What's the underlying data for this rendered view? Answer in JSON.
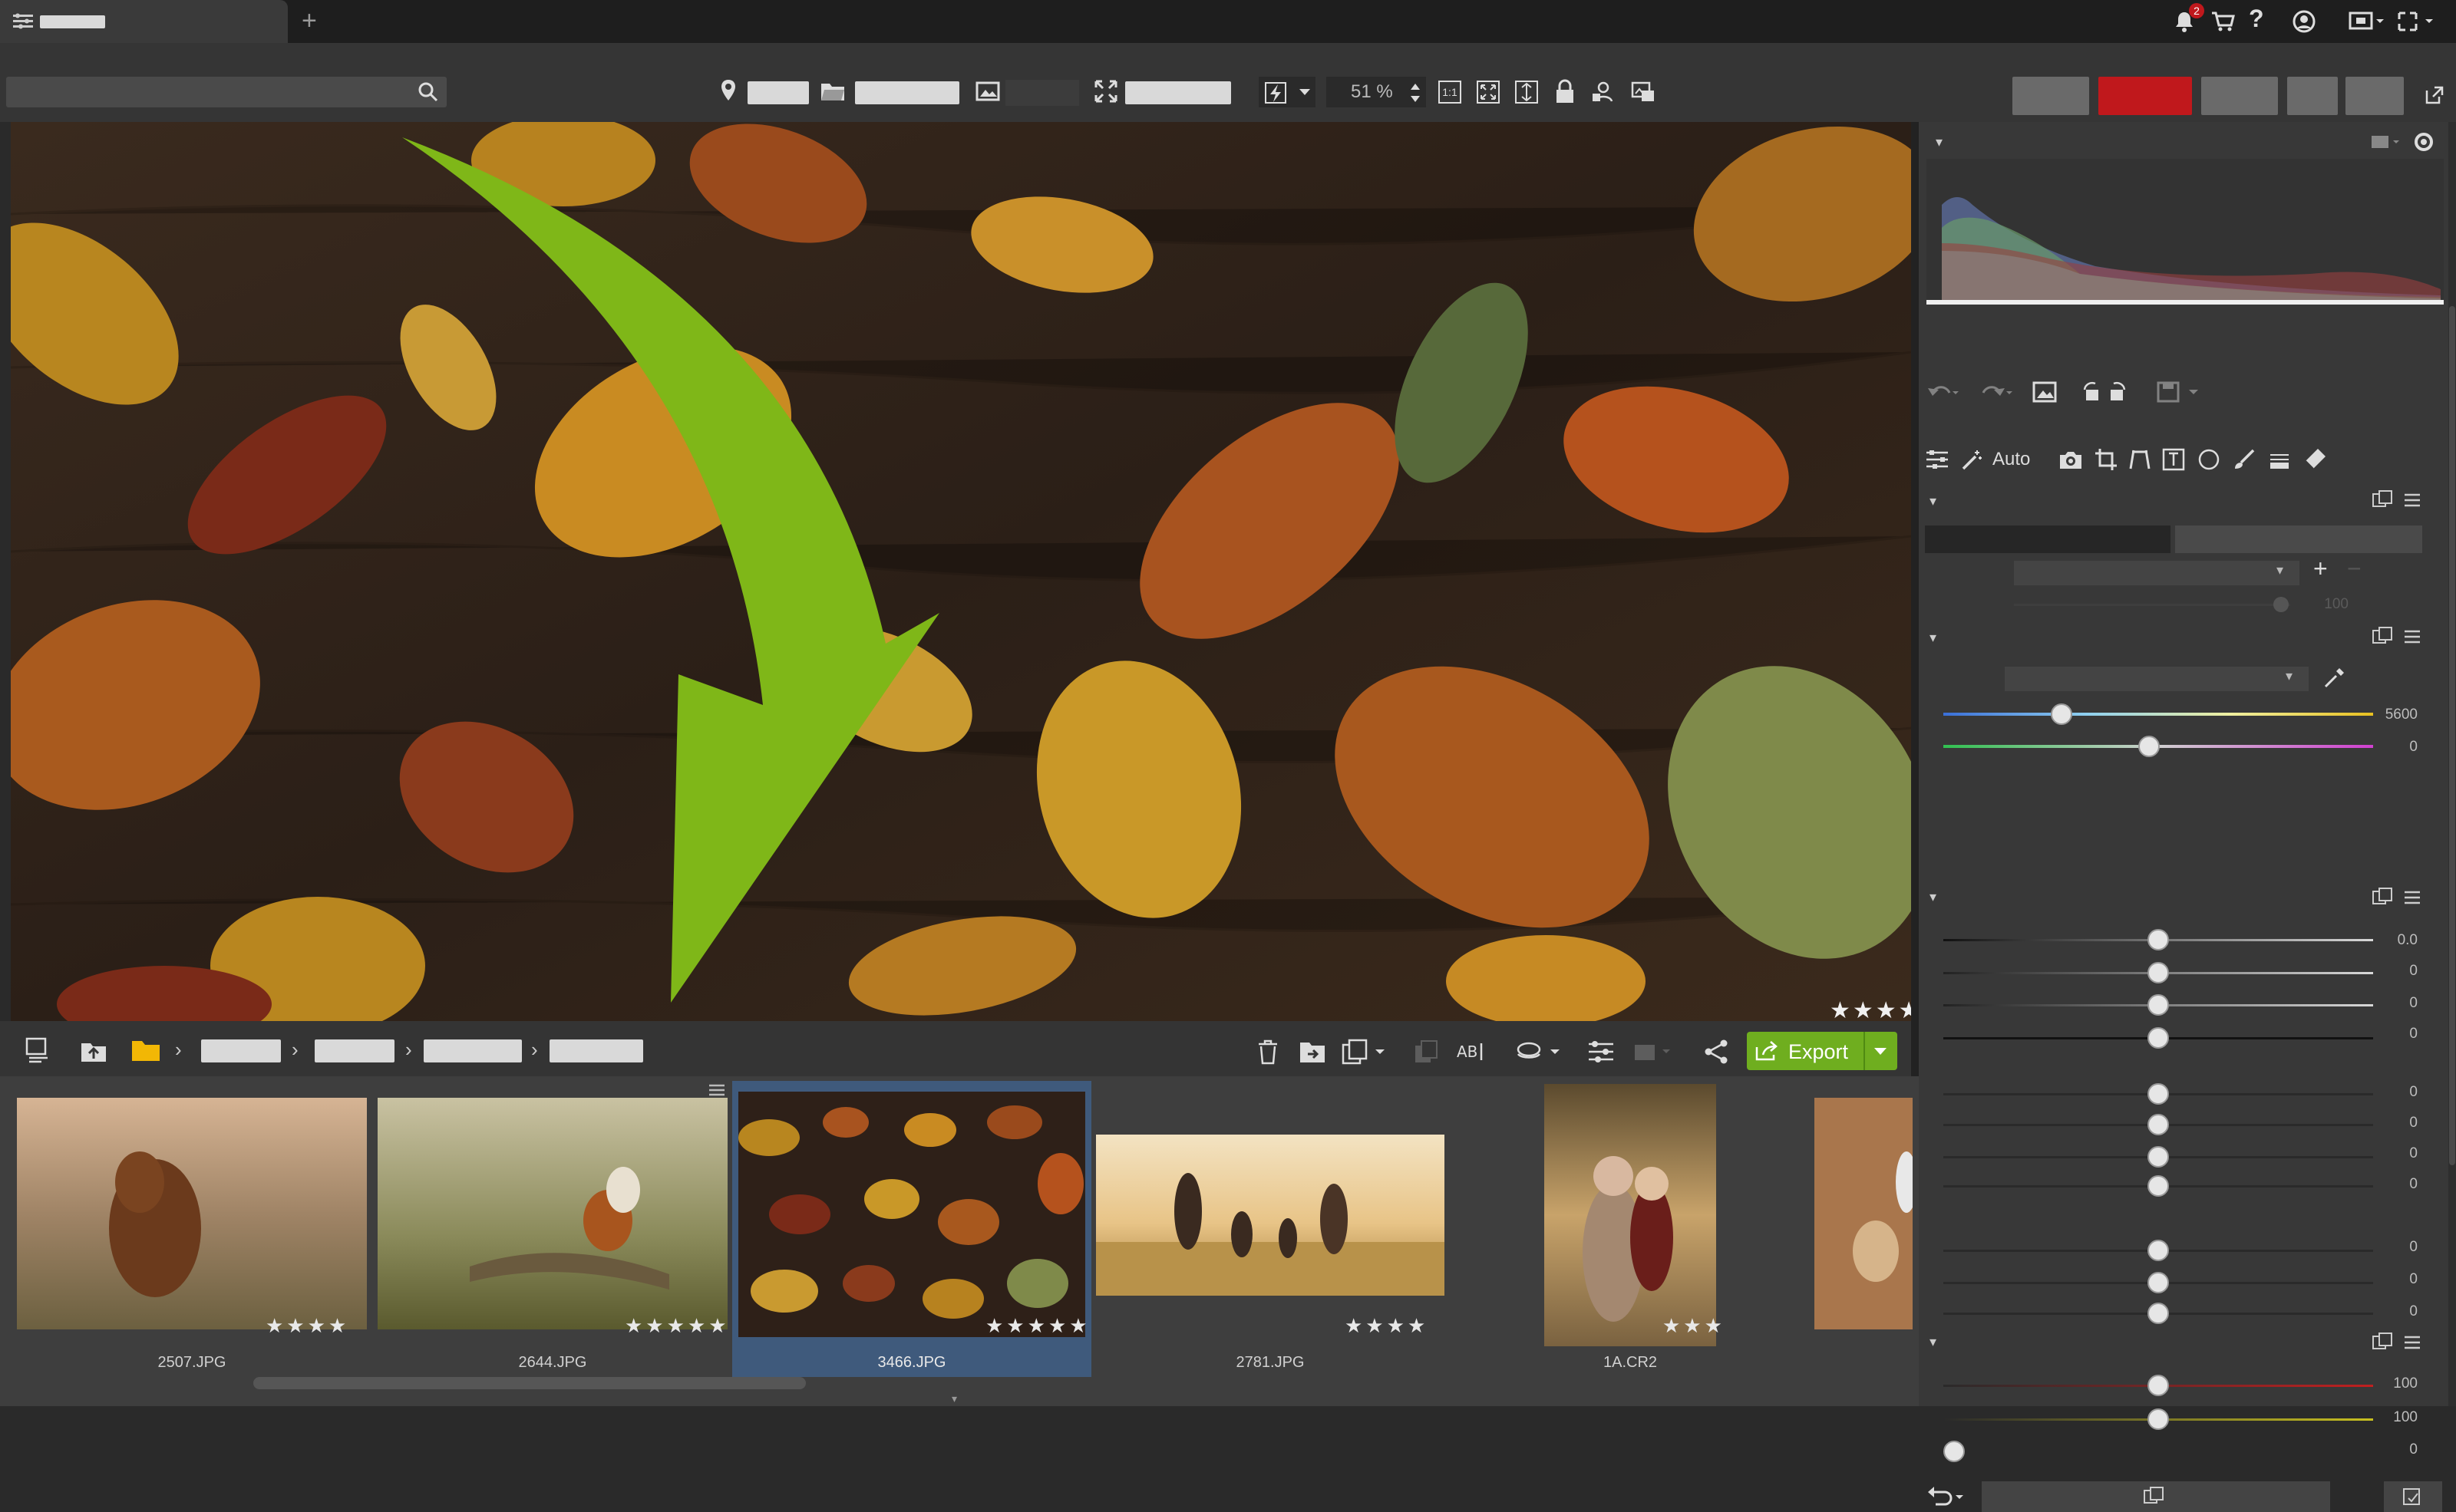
{
  "titlebar": {
    "tab_icon": "menu-icon",
    "new_tab": "+",
    "notification_count": "2"
  },
  "toolbar": {
    "zoom": "51 %",
    "zoom_1to1": "1:1"
  },
  "viewer": {
    "rating": "★★★★★"
  },
  "rightpanel": {
    "auto_label": "Auto",
    "wb_temp": "5600",
    "wb_tint": "0",
    "exposure": "0.0",
    "vals_a": [
      "0",
      "0",
      "0"
    ],
    "vals_b": [
      "0",
      "0",
      "0",
      "0"
    ],
    "vals_c": [
      "0",
      "0",
      "0"
    ],
    "vals_d": [
      "100",
      "100",
      "0"
    ],
    "slider_faint": "100"
  },
  "bottombar": {
    "export_label": "Export"
  },
  "filmstrip": {
    "items": [
      {
        "name": "2507.JPG",
        "stars": "★★★★"
      },
      {
        "name": "2644.JPG",
        "stars": "★★★★★"
      },
      {
        "name": "3466.JPG",
        "stars": "★★★★★"
      },
      {
        "name": "2781.JPG",
        "stars": "★★★★"
      },
      {
        "name": "1A.CR2",
        "stars": "★★★"
      }
    ]
  },
  "colors": {
    "accent_red": "#c0181c",
    "export_green": "#6fae1f",
    "arrow_green": "#7fb718",
    "selected_bg": "#3f5a7c"
  }
}
